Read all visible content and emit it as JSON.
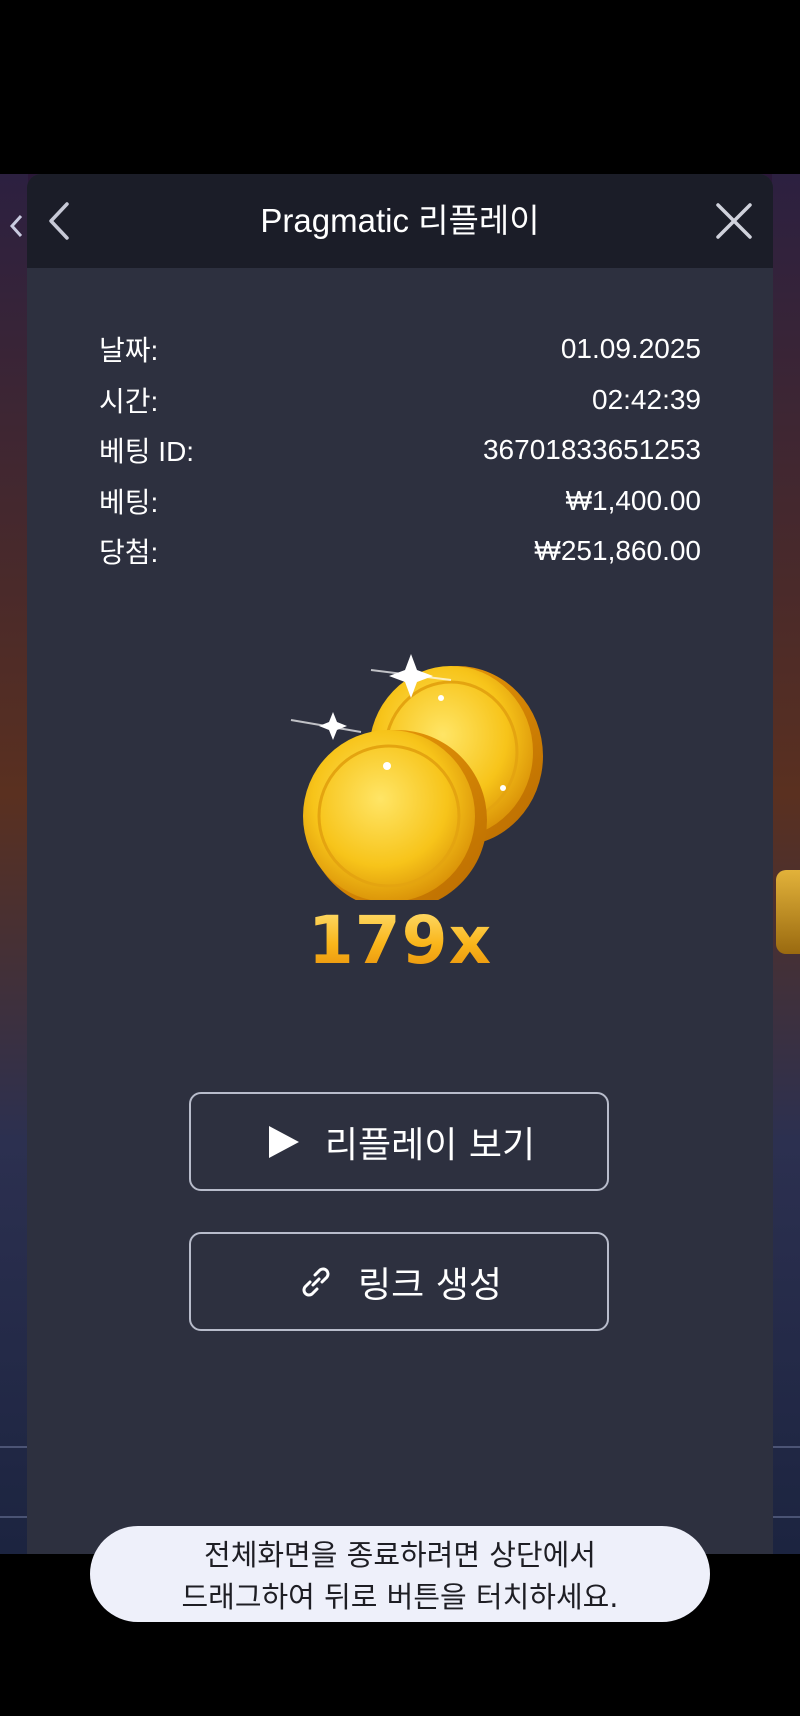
{
  "modal": {
    "title": "Pragmatic 리플레이",
    "back_icon": "chevron-left-icon",
    "close_icon": "close-icon"
  },
  "info": [
    {
      "label": "날짜:",
      "value": "01.09.2025"
    },
    {
      "label": "시간:",
      "value": "02:42:39"
    },
    {
      "label": "베팅 ID:",
      "value": "36701833651253"
    },
    {
      "label": "베팅:",
      "value": "₩1,400.00"
    },
    {
      "label": "당첨:",
      "value": "₩251,860.00"
    }
  ],
  "result": {
    "multiplier": "179x",
    "icon": "gold-coins-icon"
  },
  "buttons": {
    "replay_label": "리플레이 보기",
    "replay_icon": "play-icon",
    "link_label": "링크 생성",
    "link_icon": "link-icon"
  },
  "toast": {
    "line1": "전체화면을 종료하려면 상단에서",
    "line2": "드래그하여 뒤로 버튼을 터치하세요."
  },
  "colors": {
    "modal_bg": "#2d303f",
    "header_bg": "#1b1d28",
    "multiplier_gold": "#f7b81c",
    "toast_bg": "#eef0fa"
  }
}
